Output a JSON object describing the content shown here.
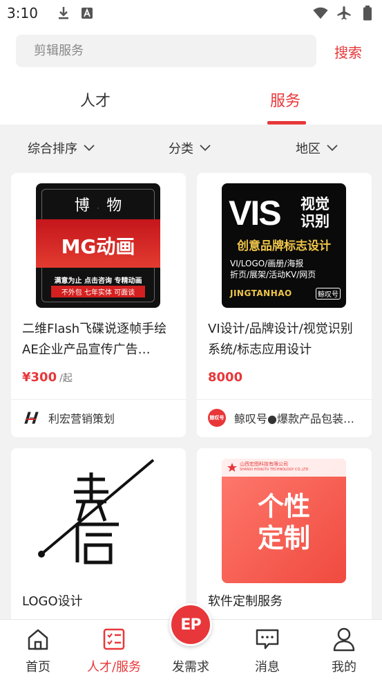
{
  "status_bar": {
    "time": "3:10"
  },
  "search": {
    "placeholder": "剪辑服务",
    "button": "搜索"
  },
  "tabs": [
    {
      "label": "人才",
      "active": false
    },
    {
      "label": "服务",
      "active": true
    }
  ],
  "filters": [
    {
      "label": "综合排序"
    },
    {
      "label": "分类"
    },
    {
      "label": "地区"
    }
  ],
  "cards": [
    {
      "thumb": {
        "top": "博",
        "top2": "物",
        "main": "MG动画",
        "line1": "满意为止  点击咨询  专精动画",
        "line2": "不外包  七年实体  可面谈"
      },
      "title": "二维Flash飞碟说逐帧手绘AE企业产品宣传广告…",
      "price": "¥300",
      "unit": "/起",
      "seller": "利宏营销策划"
    },
    {
      "thumb": {
        "big": "VIS",
        "side1": "视觉",
        "side2": "识别",
        "main": "创意品牌标志设计",
        "line1": "VI/LOGO/画册/海报",
        "line2": "折页/展架/活动KV/网页",
        "brand": "JINGTANHAO",
        "brand_mark": "鲸叹号"
      },
      "title": "VI设计/品牌设计/视觉识别系统/标志应用设计",
      "price": "8000",
      "unit": "",
      "seller": "鲸叹号●爆款产品包装…",
      "seller_logo": "鲸叹号"
    },
    {
      "title": "LOGO设计"
    },
    {
      "thumb": {
        "company": "山西宏图科技有限公司",
        "company_en": "SHANXI HONGTU TECHNOLOGY CO.,LTD",
        "line1": "个性",
        "line2": "定制"
      },
      "title": "软件定制服务"
    }
  ],
  "bottom_nav": [
    {
      "label": "首页",
      "icon": "home-icon",
      "active": false
    },
    {
      "label": "人才/服务",
      "icon": "checklist-icon",
      "active": true
    },
    {
      "label": "发需求",
      "icon": "ep-logo",
      "active": false,
      "badge": "EP"
    },
    {
      "label": "消息",
      "icon": "message-icon",
      "active": false
    },
    {
      "label": "我的",
      "icon": "user-icon",
      "active": false
    }
  ],
  "colors": {
    "accent": "#e8373a",
    "background": "#f2f2f2"
  }
}
